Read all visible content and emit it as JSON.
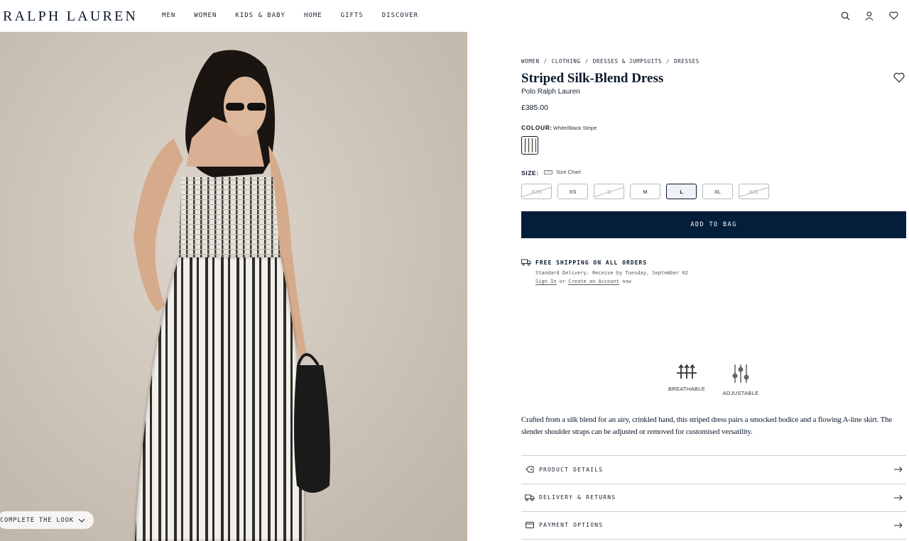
{
  "header": {
    "logo": "RALPH LAUREN",
    "nav": [
      "MEN",
      "WOMEN",
      "KIDS & BABY",
      "HOME",
      "GIFTS",
      "DISCOVER"
    ],
    "icons": [
      "search-icon",
      "account-icon",
      "wishlist-icon"
    ]
  },
  "hero": {
    "complete_the_look": "COMPLETE THE LOOK"
  },
  "product": {
    "breadcrumb": [
      "WOMEN",
      "CLOTHING",
      "DRESSES & JUMPSUITS",
      "DRESSES"
    ],
    "breadcrumb_separator": "/",
    "title": "Striped Silk-Blend Dress",
    "brand": "Polo Ralph Lauren",
    "price": "£385.00",
    "colour_label": "COLOUR:",
    "colour_value": "White/Black Stripe",
    "size_label": "SIZE:",
    "size_chart": "Size Chart",
    "sizes": [
      {
        "label": "XXS",
        "available": false
      },
      {
        "label": "XS",
        "available": true
      },
      {
        "label": "S",
        "available": false
      },
      {
        "label": "M",
        "available": true
      },
      {
        "label": "L",
        "available": true,
        "selected": true
      },
      {
        "label": "XL",
        "available": true
      },
      {
        "label": "XXL",
        "available": false
      }
    ],
    "add_to_bag": "ADD TO BAG"
  },
  "shipping": {
    "title": "FREE SHIPPING ON ALL ORDERS",
    "standard": "Standard Delivery: Receive by Tuesday, September 02",
    "sign_in": "Sign In",
    "or": " or ",
    "create_account": "Create an Account",
    "now": " now"
  },
  "features": [
    {
      "label": "BREATHABLE",
      "icon": "breathable-icon"
    },
    {
      "label": "ADJUSTABLE",
      "icon": "adjustable-icon"
    }
  ],
  "description": "Crafted from a silk blend for an airy, crinkled hand, this striped dress pairs a smocked bodice and a flowing A-line skirt. The slender shoulder straps can be adjusted or removed for customised versatility.",
  "accordion": [
    {
      "label": "PRODUCT DETAILS",
      "icon": "tag-icon"
    },
    {
      "label": "DELIVERY & RETURNS",
      "icon": "truck-icon"
    },
    {
      "label": "PAYMENT OPTIONS",
      "icon": "card-icon"
    }
  ],
  "colors": {
    "navy": "#041e3a",
    "text": "#0b1a2b",
    "background": "#ffffff"
  }
}
